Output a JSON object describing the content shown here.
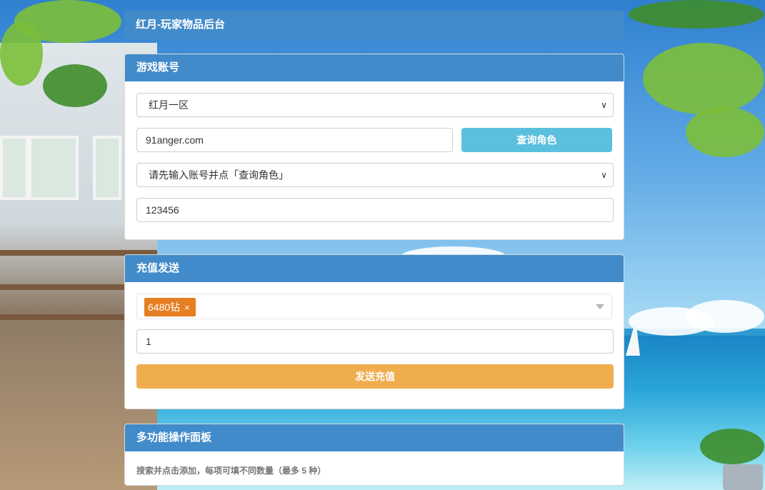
{
  "header": {
    "title": "红月-玩家物品后台"
  },
  "account_panel": {
    "title": "游戏账号",
    "server_select": {
      "selected": "红月一区"
    },
    "account_input": {
      "value": "91anger.com"
    },
    "query_button": "查询角色",
    "role_select": {
      "selected": "请先输入账号并点「查询角色」"
    },
    "password_input": {
      "value": "123456"
    }
  },
  "recharge_panel": {
    "title": "充值发送",
    "selected_items": [
      {
        "label": "6480钻",
        "remove": "×"
      }
    ],
    "quantity_input": {
      "value": "1"
    },
    "send_button": "发送充值"
  },
  "multi_panel": {
    "title": "多功能操作面板",
    "hint": "搜索并点击添加，每项可填不同数量（最多 5 种）"
  },
  "colors": {
    "primary": "#428bca",
    "info": "#5bc0de",
    "warning": "#f0ad4e",
    "tag": "#e67e22"
  }
}
